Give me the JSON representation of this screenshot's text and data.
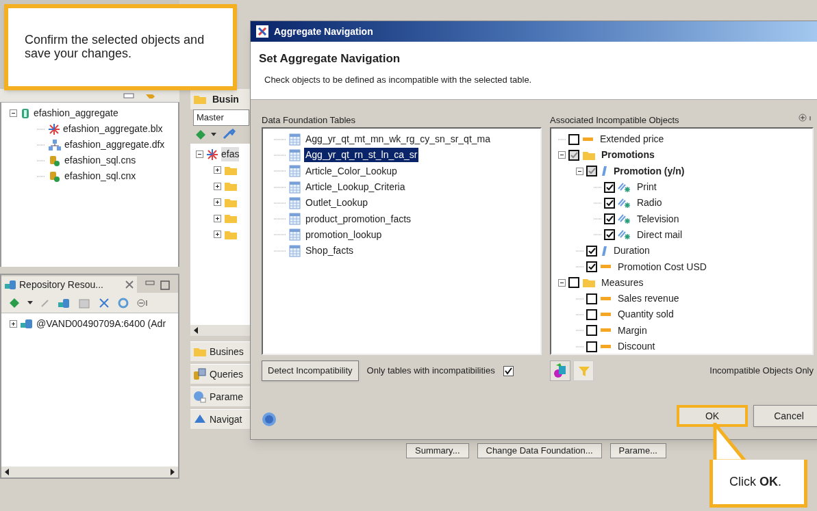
{
  "callouts": [
    {
      "kind": "top",
      "text": "Confirm the selected objects and save your changes."
    },
    {
      "kind": "bottom",
      "text": "Click **OK**."
    }
  ],
  "local_projects": {
    "tree": [
      {
        "label": "efashion_aggregate",
        "kind": "project",
        "expanded": true,
        "children": [
          {
            "label": "efashion_aggregate.blx",
            "kind": "universe"
          },
          {
            "label": "efashion_aggregate.dfx",
            "kind": "foundation"
          },
          {
            "label": "efashion_sql.cns",
            "kind": "connection"
          },
          {
            "label": "efashion_sql.cnx",
            "kind": "connection"
          }
        ]
      }
    ]
  },
  "repository_panel": {
    "tab": "Repository Resou...",
    "tree": [
      {
        "label": "@VAND00490709A:6400 (Adr",
        "expanded": false
      }
    ]
  },
  "business_layer": {
    "tab": "Busin",
    "view_field": "Master",
    "root": "efas",
    "folders": [
      {
        "expanded": false
      },
      {
        "expanded": false
      },
      {
        "expanded": false
      },
      {
        "expanded": false
      },
      {
        "expanded": false
      }
    ],
    "tabs": [
      {
        "label": "Busines",
        "kind": "folder"
      },
      {
        "label": "Queries",
        "kind": "query"
      },
      {
        "label": "Parame",
        "kind": "param"
      },
      {
        "label": "Navigat",
        "kind": "nav"
      }
    ]
  },
  "bottom_buttons": [
    "Summary...",
    "Change Data Foundation...",
    "Parame..."
  ],
  "dialog": {
    "title": "Aggregate Navigation",
    "heading": "Set Aggregate Navigation",
    "description": "Check objects to be defined as incompatible with the selected table.",
    "tables_label": "Data Foundation Tables",
    "tables": [
      {
        "label": "Agg_yr_qt_mt_mn_wk_rg_cy_sn_sr_qt_ma",
        "selected": false
      },
      {
        "label": "Agg_yr_qt_rn_st_ln_ca_sr",
        "selected": true
      },
      {
        "label": "Article_Color_Lookup",
        "selected": false
      },
      {
        "label": "Article_Lookup_Criteria",
        "selected": false
      },
      {
        "label": "Outlet_Lookup",
        "selected": false
      },
      {
        "label": "product_promotion_facts",
        "selected": false
      },
      {
        "label": "promotion_lookup",
        "selected": false
      },
      {
        "label": "Shop_facts",
        "selected": false
      }
    ],
    "objects_label": "Associated Incompatible Objects",
    "objects": [
      {
        "label": "Extended price",
        "kind": "measure",
        "checked": false,
        "grayed": false,
        "bold": false
      },
      {
        "label": "Promotions",
        "kind": "folder",
        "checked": true,
        "grayed": true,
        "bold": true,
        "expanded": true,
        "children": [
          {
            "label": "Promotion (y/n)",
            "kind": "dimension",
            "checked": true,
            "grayed": true,
            "bold": true,
            "expanded": true,
            "children": [
              {
                "label": "Print",
                "kind": "attribute",
                "checked": true,
                "grayed": false,
                "bold": false
              },
              {
                "label": "Radio",
                "kind": "attribute",
                "checked": true,
                "grayed": false,
                "bold": false
              },
              {
                "label": "Television",
                "kind": "attribute",
                "checked": true,
                "grayed": false,
                "bold": false
              },
              {
                "label": "Direct mail",
                "kind": "attribute",
                "checked": true,
                "grayed": false,
                "bold": false
              }
            ]
          },
          {
            "label": "Duration",
            "kind": "dimension",
            "checked": true,
            "grayed": false,
            "bold": false
          },
          {
            "label": "Promotion Cost USD",
            "kind": "measure",
            "checked": true,
            "grayed": false,
            "bold": false
          }
        ]
      },
      {
        "label": "Measures",
        "kind": "folder",
        "checked": false,
        "grayed": false,
        "bold": false,
        "expanded": true,
        "children": [
          {
            "label": "Sales revenue",
            "kind": "measure",
            "checked": false,
            "grayed": false,
            "bold": false
          },
          {
            "label": "Quantity sold",
            "kind": "measure",
            "checked": false,
            "grayed": false,
            "bold": false
          },
          {
            "label": "Margin",
            "kind": "measure",
            "checked": false,
            "grayed": false,
            "bold": false
          },
          {
            "label": "Discount",
            "kind": "measure",
            "checked": false,
            "grayed": false,
            "bold": false
          }
        ]
      }
    ],
    "detect_button": "Detect Incompatibility",
    "only_tables": {
      "label": "Only tables with incompatibilities",
      "checked": true
    },
    "incompatible_only": "Incompatible Objects Only",
    "buttons": [
      {
        "label": "OK",
        "highlighted": true
      },
      {
        "label": "Cancel",
        "highlighted": false
      }
    ]
  }
}
